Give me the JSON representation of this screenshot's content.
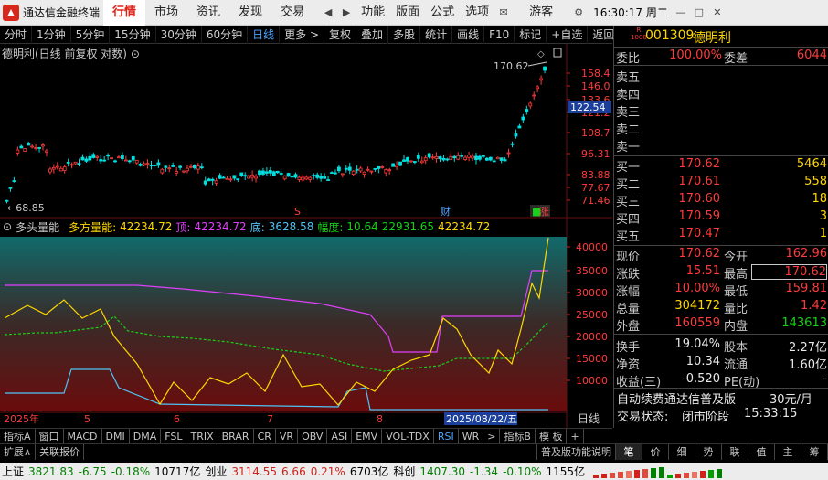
{
  "titlebar": {
    "app_name": "通达信金融终端",
    "menus": [
      "行情",
      "市场",
      "资讯",
      "发现",
      "交易"
    ],
    "right_menus": [
      "功能",
      "版面",
      "公式",
      "选项"
    ],
    "user": "游客",
    "clock": "16:30:17 周二"
  },
  "toolbar": [
    "分时",
    "1分钟",
    "5分钟",
    "15分钟",
    "30分钟",
    "60分钟",
    "日线",
    "更多 >",
    "复权",
    "叠加",
    "多股",
    "统计",
    "画线",
    "F10",
    "标记",
    "+自选",
    "返回"
  ],
  "chart": {
    "label": "德明利(日线 前复权 对数)",
    "last_price": "170.62",
    "low_label": "68.85",
    "cursor_price": "122.54",
    "price_ticks": [
      "158.4",
      "146.0",
      "133.6",
      "121.2",
      "108.7",
      "96.31",
      "83.88",
      "77.67",
      "71.46"
    ],
    "markers": [
      "S",
      "财",
      "涨"
    ],
    "marker_tip": "■"
  },
  "indicator": {
    "name": "多头量能",
    "title": "多方量能:",
    "v1": "42234.72",
    "l2": "顶:",
    "v2": "42234.72",
    "l3": "底:",
    "v3": "3628.58",
    "l4": "幅度:",
    "v4": "10.64",
    "v5": "22931.65",
    "v6": "42234.72",
    "ticks": [
      "40000",
      "35000",
      "30000",
      "25000",
      "20000",
      "15000",
      "10000"
    ]
  },
  "date_axis": {
    "labels": [
      "2025年",
      "5",
      "6",
      "7",
      "8"
    ],
    "cursor_date": "2025/08/22/五",
    "period": "日线"
  },
  "right": {
    "code": "001309",
    "name": "德明利",
    "wei_bi_l": "委比",
    "wei_bi": "100.00%",
    "wei_cha_l": "委差",
    "wei_cha": "6044",
    "sells": [
      "卖五",
      "卖四",
      "卖三",
      "卖二",
      "卖一"
    ],
    "buys": [
      {
        "l": "买一",
        "p": "170.62",
        "v": "5464"
      },
      {
        "l": "买二",
        "p": "170.61",
        "v": "558"
      },
      {
        "l": "买三",
        "p": "170.60",
        "v": "18"
      },
      {
        "l": "买四",
        "p": "170.59",
        "v": "3"
      },
      {
        "l": "买五",
        "p": "170.47",
        "v": "1"
      }
    ],
    "stats": [
      {
        "l1": "现价",
        "v1": "170.62",
        "c1": "red",
        "l2": "今开",
        "v2": "162.96",
        "c2": "red"
      },
      {
        "l1": "涨跌",
        "v1": "15.51",
        "c1": "red",
        "l2": "最高",
        "v2": "170.62",
        "c2": "red"
      },
      {
        "l1": "涨幅",
        "v1": "10.00%",
        "c1": "red",
        "l2": "最低",
        "v2": "159.81",
        "c2": "red"
      },
      {
        "l1": "总量",
        "v1": "304172",
        "c1": "yellow",
        "l2": "量比",
        "v2": "1.42",
        "c2": "red"
      },
      {
        "l1": "外盘",
        "v1": "160559",
        "c1": "red",
        "l2": "内盘",
        "v2": "143613",
        "c2": "green"
      },
      {
        "l1": "换手",
        "v1": "19.04%",
        "c1": "white",
        "l2": "股本",
        "v2": "2.27亿",
        "c2": "white"
      },
      {
        "l1": "净资",
        "v1": "10.34",
        "c1": "white",
        "l2": "流通",
        "v2": "1.60亿",
        "c2": "white"
      },
      {
        "l1": "收益(三)",
        "v1": "-0.520",
        "c1": "white",
        "l2": "PE(动)",
        "v2": "-",
        "c2": "white"
      }
    ],
    "promo": "自动续费通达信普及版",
    "promo_price": "30元/月",
    "trade_state_l": "交易状态:",
    "trade_state": "闭市阶段",
    "trade_time": "15:33:15"
  },
  "btabs": [
    "指标A",
    "窗口",
    "MACD",
    "DMI",
    "DMA",
    "FSL",
    "TRIX",
    "BRAR",
    "CR",
    "VR",
    "OBV",
    "ASI",
    "EMV",
    "VOL-TDX",
    "RSI",
    "WR",
    ">",
    "指标B",
    "模 板",
    "+"
  ],
  "btabs2": [
    "扩展∧",
    "关联报价"
  ],
  "rtabs": [
    "笔",
    "价",
    "细",
    "势",
    "联",
    "值",
    "主",
    "筹"
  ],
  "btabs_right": "普及版功能说明",
  "status": {
    "sh_l": "上证",
    "sh": "3821.83",
    "sh_chg": "-6.75",
    "sh_pct": "-0.18%",
    "sh_amt": "10717亿",
    "cy_l": "创业",
    "cy": "3114.55",
    "cy_chg": "6.66",
    "cy_pct": "0.21%",
    "cy_amt": "6703亿",
    "kc_l": "科创",
    "kc": "1407.30",
    "kc_chg": "-1.34",
    "kc_pct": "-0.10%",
    "kc_amt": "1155亿"
  },
  "colors": {
    "up": "#ff3b3b",
    "down": "#00e0e0",
    "ma_top": "#e040fb",
    "ma_bottom": "#4fc3f7",
    "yellow": "#ffd700"
  }
}
